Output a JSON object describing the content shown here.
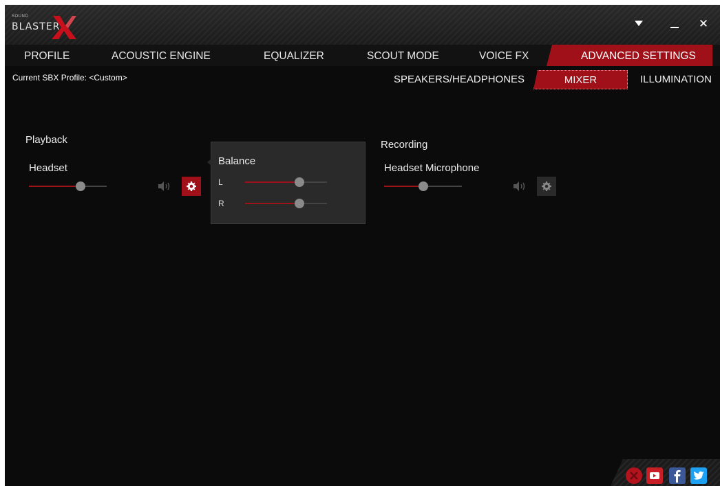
{
  "app": {
    "logo_small": "SOUND",
    "logo_word": "BLASTER",
    "brand_color": "#a01019"
  },
  "window_controls": {
    "menu_icon": "triangle-down-icon",
    "minimize_icon": "minimize-icon",
    "close_label": "✕"
  },
  "tabs": [
    {
      "label": "PROFILE",
      "active": false
    },
    {
      "label": "ACOUSTIC ENGINE",
      "active": false
    },
    {
      "label": "EQUALIZER",
      "active": false
    },
    {
      "label": "SCOUT MODE",
      "active": false
    },
    {
      "label": "VOICE FX",
      "active": false
    },
    {
      "label": "ADVANCED SETTINGS",
      "active": true
    }
  ],
  "profile": {
    "label": "Current SBX Profile: <Custom>"
  },
  "subtabs": [
    {
      "label": "SPEAKERS/HEADPHONES",
      "active": false
    },
    {
      "label": "MIXER",
      "active": true
    },
    {
      "label": "ILLUMINATION",
      "active": false
    }
  ],
  "playback": {
    "title": "Playback",
    "device": "Headset",
    "volume_fraction": 0.66,
    "settings_active": true
  },
  "balance": {
    "title": "Balance",
    "left_label": "L",
    "right_label": "R",
    "left_fraction": 0.66,
    "right_fraction": 0.66
  },
  "recording": {
    "title": "Recording",
    "device": "Headset Microphone",
    "volume_fraction": 0.5,
    "settings_active": false
  },
  "social": [
    "sbx-close-icon",
    "youtube-icon",
    "facebook-icon",
    "twitter-icon"
  ]
}
